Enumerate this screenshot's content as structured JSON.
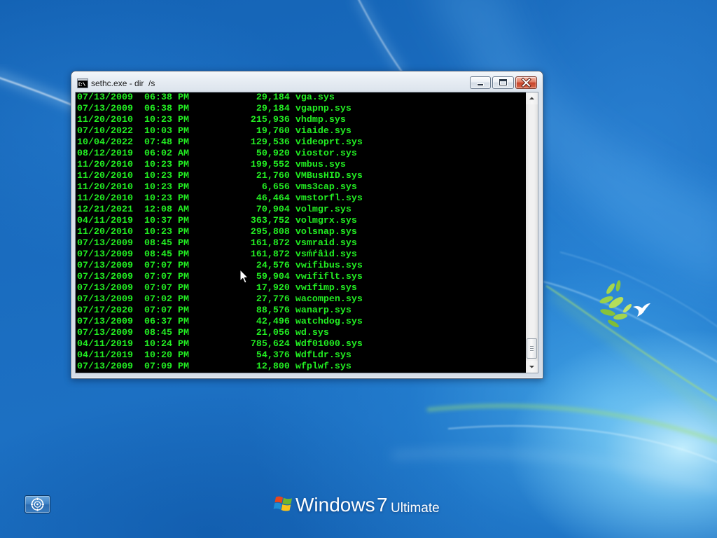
{
  "window": {
    "title": "sethc.exe - dir  /s",
    "icon": "cmd-icon",
    "buttons": [
      "minimize-icon",
      "maximize-icon",
      "close-icon"
    ]
  },
  "console": {
    "text_color": "#22ee22",
    "background": "#000000",
    "lines": [
      {
        "date": "07/13/2009",
        "time": "06:38 PM",
        "size": "29,184",
        "name": "vga.sys"
      },
      {
        "date": "07/13/2009",
        "time": "06:38 PM",
        "size": "29,184",
        "name": "vgapnp.sys"
      },
      {
        "date": "11/20/2010",
        "time": "10:23 PM",
        "size": "215,936",
        "name": "vhdmp.sys"
      },
      {
        "date": "07/10/2022",
        "time": "10:03 PM",
        "size": "19,760",
        "name": "viaide.sys"
      },
      {
        "date": "10/04/2022",
        "time": "07:48 PM",
        "size": "129,536",
        "name": "videoprt.sys"
      },
      {
        "date": "08/12/2019",
        "time": "06:02 AM",
        "size": "50,920",
        "name": "viostor.sys"
      },
      {
        "date": "11/20/2010",
        "time": "10:23 PM",
        "size": "199,552",
        "name": "vmbus.sys"
      },
      {
        "date": "11/20/2010",
        "time": "10:23 PM",
        "size": "21,760",
        "name": "VMBusHID.sys"
      },
      {
        "date": "11/20/2010",
        "time": "10:23 PM",
        "size": "6,656",
        "name": "vms3cap.sys"
      },
      {
        "date": "11/20/2010",
        "time": "10:23 PM",
        "size": "46,464",
        "name": "vmstorfl.sys"
      },
      {
        "date": "12/21/2021",
        "time": "12:08 AM",
        "size": "70,904",
        "name": "volmgr.sys"
      },
      {
        "date": "04/11/2019",
        "time": "10:37 PM",
        "size": "363,752",
        "name": "volmgrx.sys"
      },
      {
        "date": "11/20/2010",
        "time": "10:23 PM",
        "size": "295,808",
        "name": "volsnap.sys"
      },
      {
        "date": "07/13/2009",
        "time": "08:45 PM",
        "size": "161,872",
        "name": "vsmraid.sys"
      },
      {
        "date": "07/13/2009",
        "time": "08:45 PM",
        "size": "161,872",
        "name": "vsḿŕâìd.sys"
      },
      {
        "date": "07/13/2009",
        "time": "07:07 PM",
        "size": "24,576",
        "name": "vwifibus.sys"
      },
      {
        "date": "07/13/2009",
        "time": "07:07 PM",
        "size": "59,904",
        "name": "vwififlt.sys"
      },
      {
        "date": "07/13/2009",
        "time": "07:07 PM",
        "size": "17,920",
        "name": "vwifimp.sys"
      },
      {
        "date": "07/13/2009",
        "time": "07:02 PM",
        "size": "27,776",
        "name": "wacompen.sys"
      },
      {
        "date": "07/17/2020",
        "time": "07:07 PM",
        "size": "88,576",
        "name": "wanarp.sys"
      },
      {
        "date": "07/13/2009",
        "time": "06:37 PM",
        "size": "42,496",
        "name": "watchdog.sys"
      },
      {
        "date": "07/13/2009",
        "time": "08:45 PM",
        "size": "21,056",
        "name": "wd.sys"
      },
      {
        "date": "04/11/2019",
        "time": "10:24 PM",
        "size": "785,624",
        "name": "Wdf01000.sys"
      },
      {
        "date": "04/11/2019",
        "time": "10:20 PM",
        "size": "54,376",
        "name": "WdfLdr.sys"
      },
      {
        "date": "07/13/2009",
        "time": "07:09 PM",
        "size": "12,800",
        "name": "wfplwf.sys"
      }
    ]
  },
  "scrollbar": {
    "scroll_position": 0.99,
    "icons": [
      "arrow-up-icon",
      "arrow-down-icon"
    ]
  },
  "branding": {
    "logo": "windows-flag-icon",
    "windows": "Windows",
    "version": "7",
    "edition": "Ultimate"
  },
  "ease_of_access": {
    "icon": "ease-of-access-icon"
  },
  "colors": {
    "close_button": "#c8432a",
    "flag_red": "#e8461c",
    "flag_green": "#71b52d",
    "flag_blue": "#1d8fd6",
    "flag_yellow": "#f9c21a"
  }
}
